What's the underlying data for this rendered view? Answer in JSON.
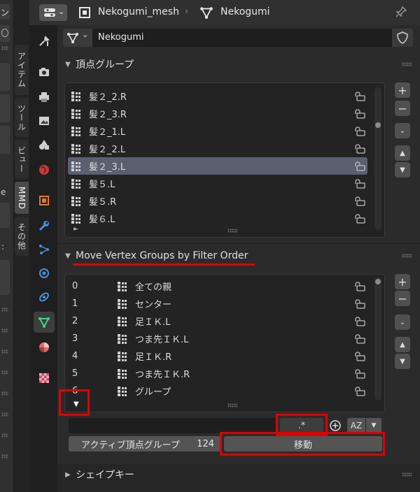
{
  "header": {
    "mesh_name": "Nekogumi_mesh",
    "object_name": "Nekogumi",
    "pin_icon": "pin-icon"
  },
  "datablock": {
    "name": "Nekogumi"
  },
  "vertical_tabs": [
    "アイテム",
    "ツール",
    "ビュー",
    "MMD",
    "その他"
  ],
  "left_strip": {
    "fragment_top": "ン",
    "fragment_e": "e",
    "fragment_colon": ":"
  },
  "vertex_groups_panel": {
    "title": "頂点グループ",
    "items": [
      {
        "name": "髪２_2.R",
        "selected": false
      },
      {
        "name": "髪２_3.R",
        "selected": false
      },
      {
        "name": "髪２_1.L",
        "selected": false
      },
      {
        "name": "髪２_2.L",
        "selected": false
      },
      {
        "name": "髪２_3.L",
        "selected": true
      },
      {
        "name": "髪５.L",
        "selected": false
      },
      {
        "name": "髪５.R",
        "selected": false
      },
      {
        "name": "髪６.L",
        "selected": false
      }
    ]
  },
  "move_panel": {
    "title": "Move Vertex Groups by Filter Order",
    "items": [
      {
        "index": "0",
        "name": "全ての親"
      },
      {
        "index": "1",
        "name": "センター"
      },
      {
        "index": "2",
        "name": "足ＩＫ.L"
      },
      {
        "index": "3",
        "name": "つま先ＩＫ.L"
      },
      {
        "index": "4",
        "name": "足ＩＫ.R"
      },
      {
        "index": "5",
        "name": "つま先ＩＫ.R"
      },
      {
        "index": "6",
        "name": "グループ"
      }
    ],
    "filter_value": "",
    "regex_value": ".*",
    "active_label": "アクティブ頂点グループ",
    "active_count": "124",
    "move_label": "移動",
    "sort_label": "AZ"
  },
  "shape_keys_panel": {
    "title": "シェイプキー"
  },
  "colors": {
    "selection": "#5a6070",
    "highlight": "#e00000",
    "vgroup_icon": "#cfcfcf",
    "active_prop_icon": "#3bd18e"
  }
}
